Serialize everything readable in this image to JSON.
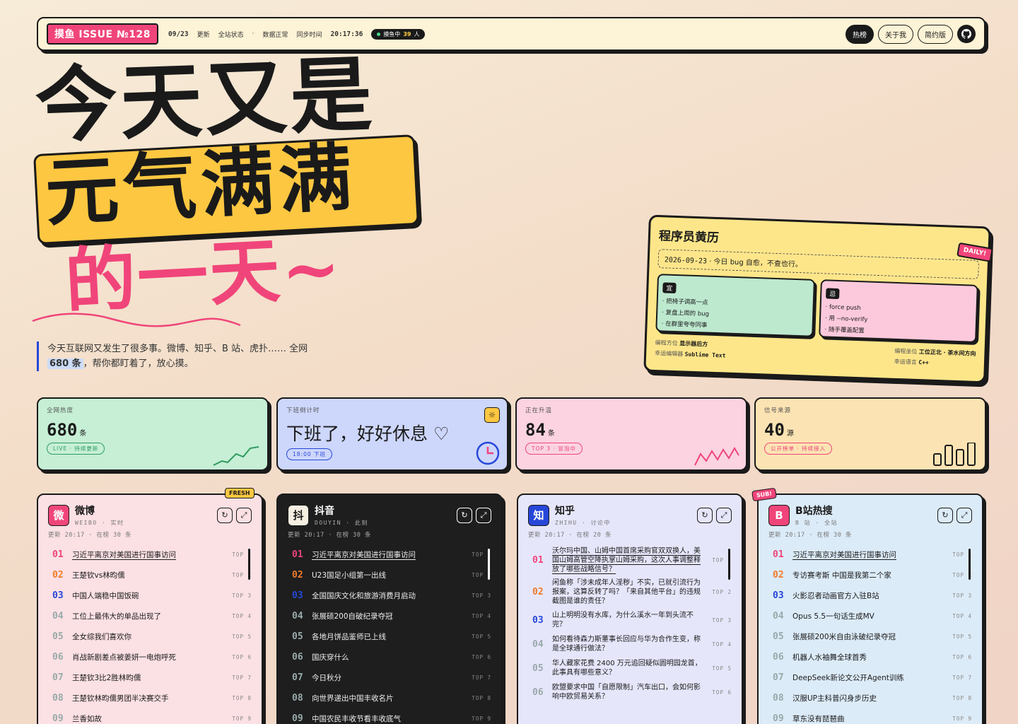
{
  "topbar": {
    "issue": "摸鱼 ISSUE №128",
    "date": "09/23",
    "update": "更新",
    "site_status_label": "全站状态",
    "site_status": "数据正常",
    "sync_label": "同步时间",
    "sync_time": "20:17:36",
    "fishing_label": "摸鱼中",
    "fishing_count": "39",
    "fishing_unit": "人",
    "nav": [
      "热榜",
      "关于我",
      "简约版"
    ]
  },
  "hero": {
    "line1": "今天又是",
    "line2": "元气满满",
    "line3": "的一天~",
    "tagline_a": "今天互联网又发生了很多事。微博、知乎、B 站、虎扑…… 全网",
    "tagline_count": "680 条",
    "tagline_b": "，帮你都盯着了，放心摸。"
  },
  "almanac": {
    "title": "程序员黄历",
    "badge": "DAILY!",
    "date": "2026-09-23",
    "quote": "今日 bug 自愈，不查也行。",
    "yi_label": "宜",
    "yi": [
      "· 把椅子调高一点",
      "· 复盘上周的 bug",
      "· 在群里夸夸同事"
    ],
    "ji_label": "忌",
    "ji": [
      "· force push",
      "· 用 --no-verify",
      "· 随手覆盖配置"
    ],
    "foot_left": [
      {
        "k": "编程方位",
        "v": "显示器后方"
      },
      {
        "k": "幸运编辑器",
        "v": "Sublime Text"
      }
    ],
    "foot_right": [
      {
        "k": "编程坐位",
        "v": "工位正北 · 茶水间方向"
      },
      {
        "k": "幸运语言",
        "v": "C++"
      }
    ]
  },
  "stats": [
    {
      "label": "全网热度",
      "value": "680",
      "unit": "条",
      "chip": "LIVE · 持续更新"
    },
    {
      "label": "下班倒计时",
      "text": "下班了，好好休息 ♡",
      "chip": "18:00 下班"
    },
    {
      "label": "正在升温",
      "value": "84",
      "unit": "条",
      "chip": "TOP 3 · 冒泡中"
    },
    {
      "label": "信号来源",
      "value": "40",
      "unit": "源",
      "chip": "公开榜单 · 持续接入"
    }
  ],
  "cards": [
    {
      "name": "微博",
      "sub": "WEIBO · 实时",
      "logo": "微",
      "badge": "FRESH",
      "meta": "更新 20:17 · 在榜 30 条",
      "items": [
        "习近平离京对美国进行国事访问",
        "王楚钦vs林昀儒",
        "中国人端稳中国饭碗",
        "工位上最伟大的单品出现了",
        "全女综我们喜欢你",
        "肖战新剧差点被姜妍一电炮呼死",
        "王楚钦3比2胜林昀儒",
        "王楚钦林昀儒男团半决赛交手",
        "兰香如故"
      ]
    },
    {
      "name": "抖音",
      "sub": "DOUYIN · 此刻",
      "logo": "抖",
      "meta": "更新 20:17 · 在榜 30 条",
      "items": [
        "习近平离京对美国进行国事访问",
        "U23国足小组第一出线",
        "全国国庆文化和旅游消费月启动",
        "张展硕200自破纪录夺冠",
        "各地月饼品鉴师已上线",
        "国庆穿什么",
        "今日秋分",
        "向世界递出中国丰收名片",
        "中国农民丰收节看丰收底气"
      ]
    },
    {
      "name": "知乎",
      "sub": "ZHIHU · 讨论中",
      "logo": "知",
      "meta": "更新 20:17 · 在榜 20 条",
      "items": [
        "沃尔玛中国、山姆中国首席采购官双双换人，美国山姆高管空降执掌山姆采购，这次人事调整释放了哪些战略信号？",
        "闲鱼称「涉未成年人淫秽」不实，已就引流行为报案，这算反转了吗？「来自其他平台」的违规截图是谁的责任？",
        "山上明明没有水库，为什么溪水一年到头流不完？",
        "如何看待森力斯董事长回应与华为合作生变，称是全球通行做法？",
        "华人藏家花费 2400 万元追回疑似圆明园龙首，此事具有哪些意义？",
        "欧盟要求中国「自愿限制」汽车出口，会如何影响中欧贸易关系？"
      ]
    },
    {
      "name": "B站热搜",
      "sub": "B 站 · 全站",
      "logo": "B",
      "badge": "SUB!",
      "meta": "更新 20:17 · 在榜 30 条",
      "items": [
        "习近平离京对美国进行国事访问",
        "专访赛考斯 中国是我第二个家",
        "火影忍者动画官方入驻B站",
        "Opus 5.5一句话生成MV",
        "张展硕200米自由泳破纪录夺冠",
        "机器人水袖舞全球首秀",
        "DeepSeek新论文公开Agent训练",
        "汉服UP主科普闪身步历史",
        "草东没有琵琶曲"
      ]
    }
  ]
}
